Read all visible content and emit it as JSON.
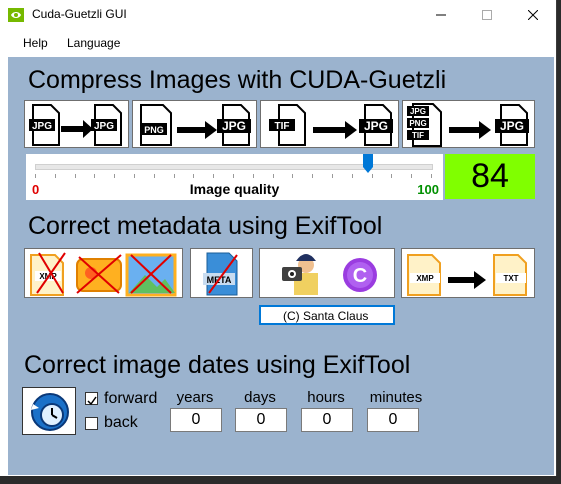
{
  "window": {
    "title": "Cuda-Guetzli GUI"
  },
  "menu": {
    "help": "Help",
    "language": "Language"
  },
  "compress": {
    "heading": "Compress Images with CUDA-Guetzli",
    "buttons": [
      {
        "from": "JPG",
        "to": "JPG"
      },
      {
        "from": "PNG",
        "to": "JPG"
      },
      {
        "from": "TIF",
        "to": "JPG"
      },
      {
        "from": [
          "JPG",
          "PNG",
          "TIF"
        ],
        "to": "JPG"
      }
    ],
    "slider": {
      "min_label": "0",
      "max_label": "100",
      "caption": "Image quality",
      "value": 84
    },
    "quality_display": "84",
    "colors": {
      "quality_bg": "#80ff00",
      "min": "#e00000",
      "max": "#009000"
    }
  },
  "metadata": {
    "heading": "Correct metadata using ExifTool",
    "icon_labels": {
      "xmp": "XMP",
      "meta": "META",
      "copyright_letter": "C",
      "xmp2": "XMP",
      "txt": "TXT"
    },
    "copyright_value": "(C) Santa Claus"
  },
  "dates": {
    "heading": "Correct image dates using ExifTool",
    "forward_label": "forward",
    "forward_checked": true,
    "back_label": "back",
    "back_checked": false,
    "fields": [
      {
        "label": "years",
        "value": "0"
      },
      {
        "label": "days",
        "value": "0"
      },
      {
        "label": "hours",
        "value": "0"
      },
      {
        "label": "minutes",
        "value": "0"
      }
    ]
  }
}
